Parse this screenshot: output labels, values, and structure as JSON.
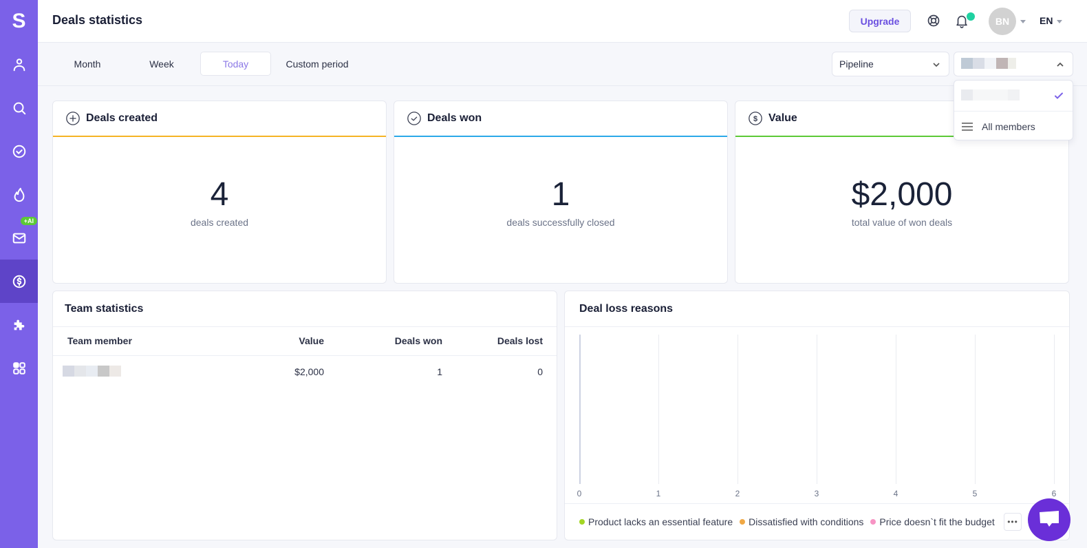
{
  "sidebar": {
    "logo": "S",
    "items": [
      {
        "name": "contacts",
        "icon": "user-icon"
      },
      {
        "name": "search",
        "icon": "search-icon"
      },
      {
        "name": "tasks",
        "icon": "check-circle-icon"
      },
      {
        "name": "hot-leads",
        "icon": "flame-icon"
      },
      {
        "name": "email",
        "icon": "mail-icon",
        "badge": "+AI"
      },
      {
        "name": "deals",
        "icon": "dollar-circle-icon",
        "active": true
      },
      {
        "name": "integrations",
        "icon": "puzzle-icon"
      },
      {
        "name": "apps",
        "icon": "grid-icon"
      }
    ]
  },
  "header": {
    "title": "Deals statistics",
    "upgrade_label": "Upgrade",
    "avatar_initials": "BN",
    "language": "EN",
    "notification_dot_color": "#1fd1a1"
  },
  "filters": {
    "periods": [
      "Month",
      "Week",
      "Today",
      "Custom period"
    ],
    "active_period": "Today",
    "pipeline_select": "Pipeline",
    "member_select_value": "",
    "member_dropdown": {
      "items": [
        {
          "label": "",
          "selected": true
        },
        {
          "label": "All members",
          "icon": "menu-icon"
        }
      ]
    }
  },
  "stats": [
    {
      "title": "Deals created",
      "icon": "plus-circle-icon",
      "value": "4",
      "caption": "deals created",
      "accent": "#f5b324"
    },
    {
      "title": "Deals won",
      "icon": "check-circle-icon",
      "value": "1",
      "caption": "deals successfully closed",
      "accent": "#2aa8e8"
    },
    {
      "title": "Value",
      "icon": "dollar-circle-icon",
      "value": "$2,000",
      "caption": "total value of won deals",
      "accent": "#5cc936"
    }
  ],
  "team_statistics": {
    "title": "Team statistics",
    "columns": [
      "Team member",
      "Value",
      "Deals won",
      "Deals lost"
    ],
    "rows": [
      {
        "member": "",
        "value": "$2,000",
        "deals_won": "1",
        "deals_lost": "0"
      }
    ]
  },
  "deal_loss": {
    "title": "Deal loss reasons",
    "more_label": "•••"
  },
  "chart_data": {
    "type": "bar",
    "orientation": "horizontal",
    "title": "Deal loss reasons",
    "xlabel": "",
    "ylabel": "",
    "xlim": [
      0,
      6
    ],
    "x_ticks": [
      "0",
      "1",
      "2",
      "3",
      "4",
      "5",
      "6"
    ],
    "grid": true,
    "legend_position": "bottom",
    "series": [
      {
        "name": "Product lacks an essential feature",
        "color": "#a3d624",
        "values": []
      },
      {
        "name": "Dissatisfied with conditions",
        "color": "#f0a845",
        "values": []
      },
      {
        "name": "Price doesn`t fit the budget",
        "color": "#f794c4",
        "values": []
      }
    ]
  }
}
